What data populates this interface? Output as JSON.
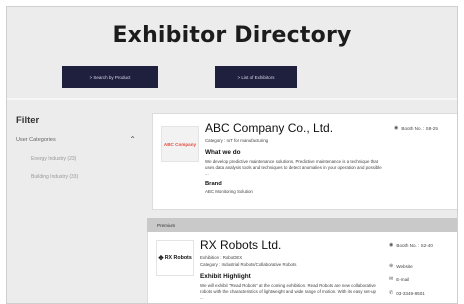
{
  "page": {
    "title": "Exhibitor Directory"
  },
  "nav": {
    "search_by_product": "> Search by Product",
    "list_of_exhibitors": "> List of Exhibitors"
  },
  "sidebar": {
    "filter_title": "Filter",
    "category_heading": "User Categories",
    "categories": [
      "Energy Industry (23)",
      "Building Industry (33)"
    ]
  },
  "exhibitors": [
    {
      "logo_text": "ABC Company",
      "name": "ABC Company Co., Ltd.",
      "category": "Category : IoT for manufacturing",
      "section_title": "What we do",
      "description": "We develop predictive maintenance solutions. Predictive maintenance is a technique that uses data analysis tools and techniques to detect anomalies in your operation and possible ...",
      "brand_title": "Brand",
      "brand": "ABC Monitoring Solution",
      "booth": "Booth No. : S8-25"
    },
    {
      "tier": "Premium",
      "logo_text": "RX Robots",
      "name": "RX Robots Ltd.",
      "exhibition": "Exhibition : RoboDEX",
      "category": "Category : Industrial Robots/Collaborative Robots",
      "section_title": "Exhibit Highlight",
      "description": "We will exhibit \"Read Robots\" at the coming exhibition. Read Robots are new collaborative robots with the characteristics of lightweight and wide range of motion. With its easy set-up ...",
      "booth": "Booth No. : S2-40",
      "website": "Website",
      "email": "E-mail",
      "phone": "03-3349-8501"
    }
  ]
}
